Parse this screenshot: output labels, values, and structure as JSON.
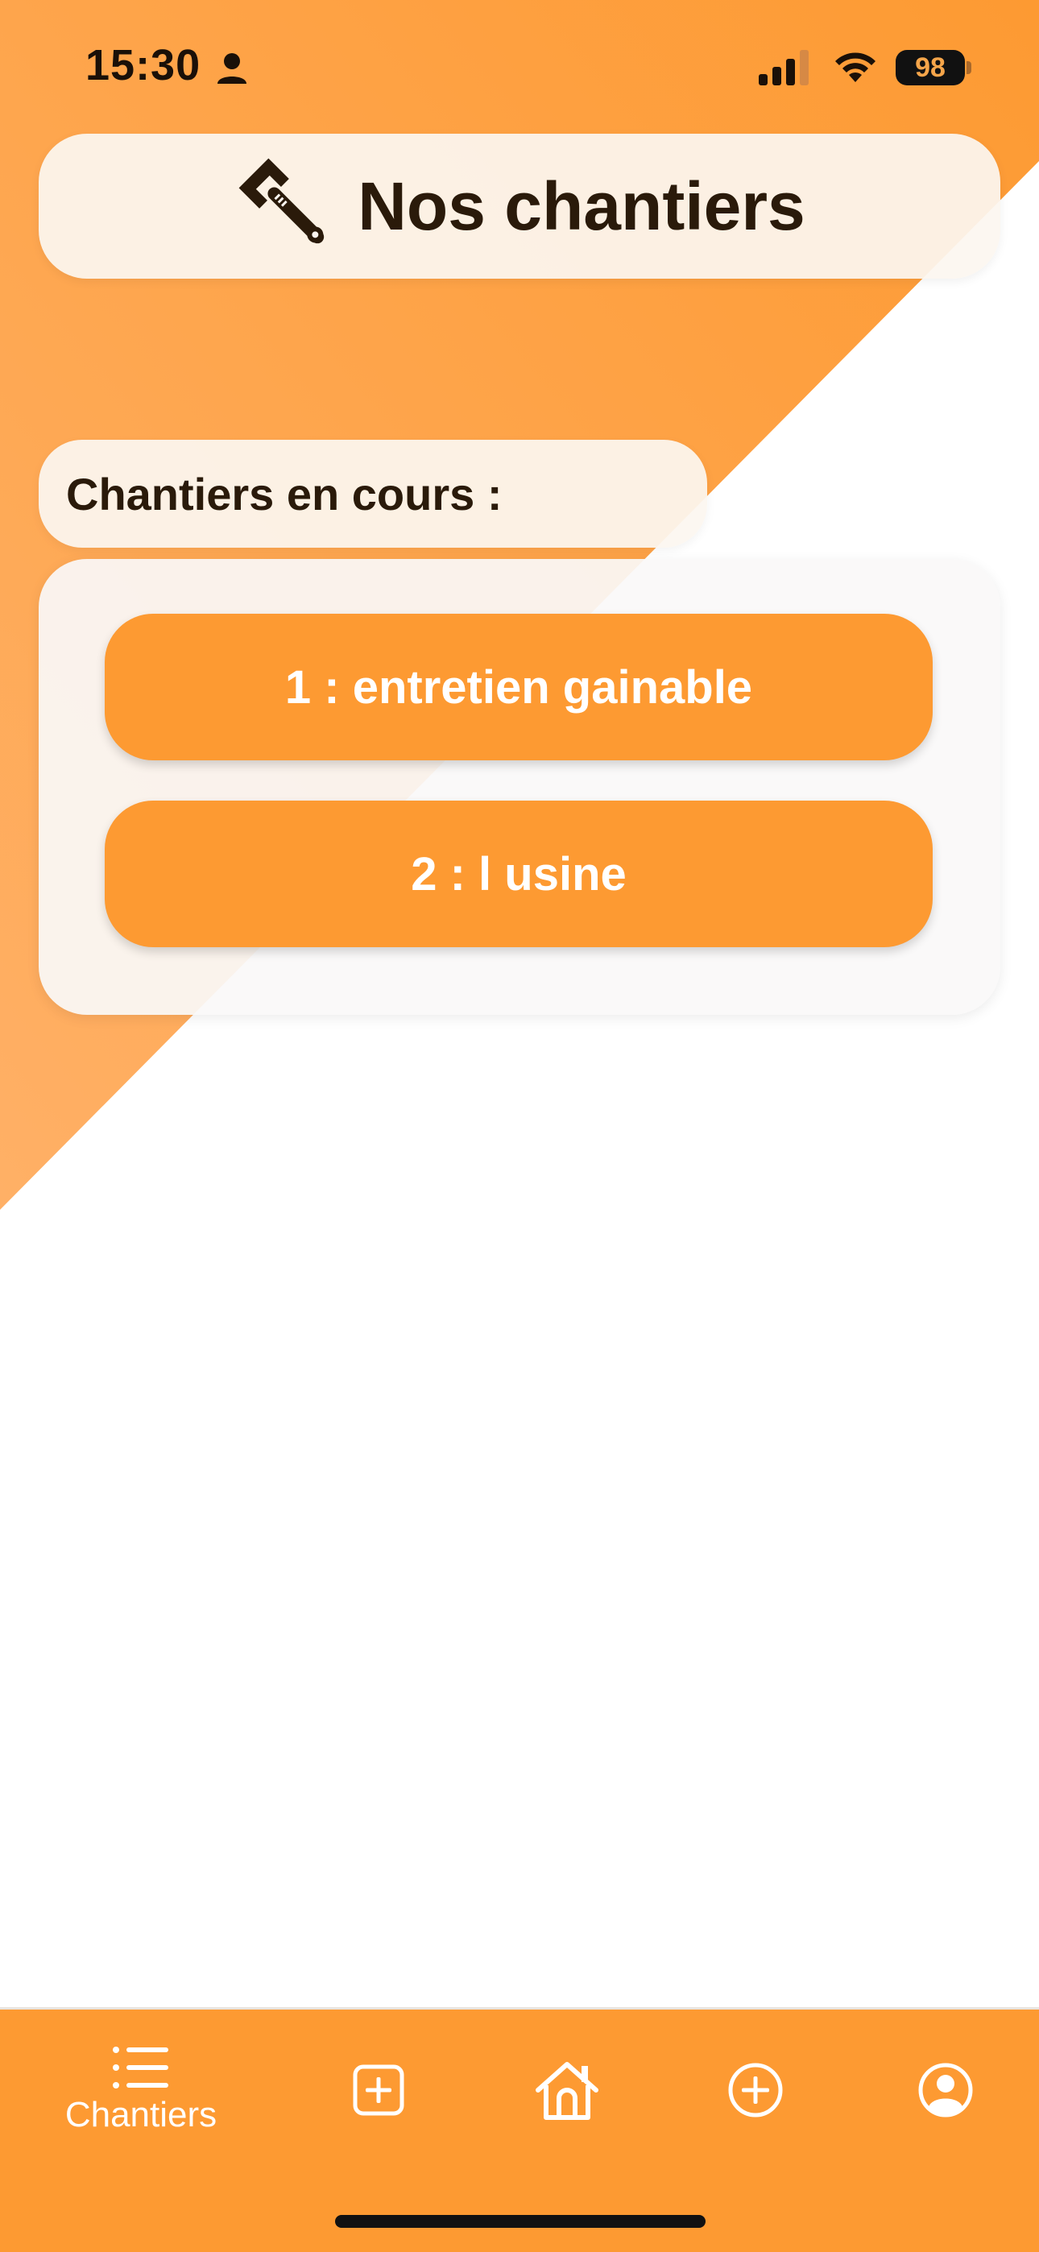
{
  "status_bar": {
    "time": "15:30",
    "battery": "98"
  },
  "header": {
    "title": "Nos chantiers",
    "icon": "wrench-icon"
  },
  "section": {
    "label": "Chantiers en cours :"
  },
  "chantiers": [
    {
      "label": "1 : entretien gainable"
    },
    {
      "label": "2 : l usine"
    }
  ],
  "tab_bar": {
    "tabs": [
      {
        "icon": "list-icon",
        "label": "Chantiers"
      },
      {
        "icon": "add-square-icon",
        "label": ""
      },
      {
        "icon": "home-icon",
        "label": ""
      },
      {
        "icon": "add-circle-icon",
        "label": ""
      },
      {
        "icon": "profile-icon",
        "label": ""
      }
    ]
  },
  "colors": {
    "accent": "#FD9A32",
    "card": "#FCF6F0",
    "text": "#2A1A0A"
  }
}
